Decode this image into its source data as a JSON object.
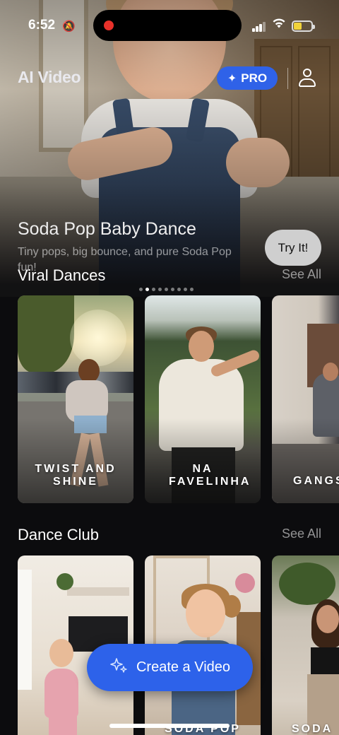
{
  "status": {
    "time": "6:52"
  },
  "header": {
    "brand": "AI Video",
    "pro_label": "PRO"
  },
  "hero": {
    "title": "Soda Pop Baby Dance",
    "subtitle": "Tiny pops, big bounce, and pure Soda Pop fun!",
    "cta": "Try It!",
    "page_count": 9,
    "active_page": 1
  },
  "sections": [
    {
      "title": "Viral Dances",
      "see_all": "See All",
      "cards": [
        {
          "label": "TWIST AND SHINE"
        },
        {
          "label": "NA FAVELINHA"
        },
        {
          "label": "GANGS"
        }
      ]
    },
    {
      "title": "Dance Club",
      "see_all": "See All",
      "cards": [
        {
          "label": ""
        },
        {
          "label": "SODA POP"
        },
        {
          "label": "SODA"
        }
      ]
    }
  ],
  "create_button": {
    "label": "Create a Video"
  },
  "colors": {
    "accent": "#2f62e8",
    "background": "#0c0c0e",
    "battery": "#f1d33b",
    "record": "#e8312a"
  }
}
